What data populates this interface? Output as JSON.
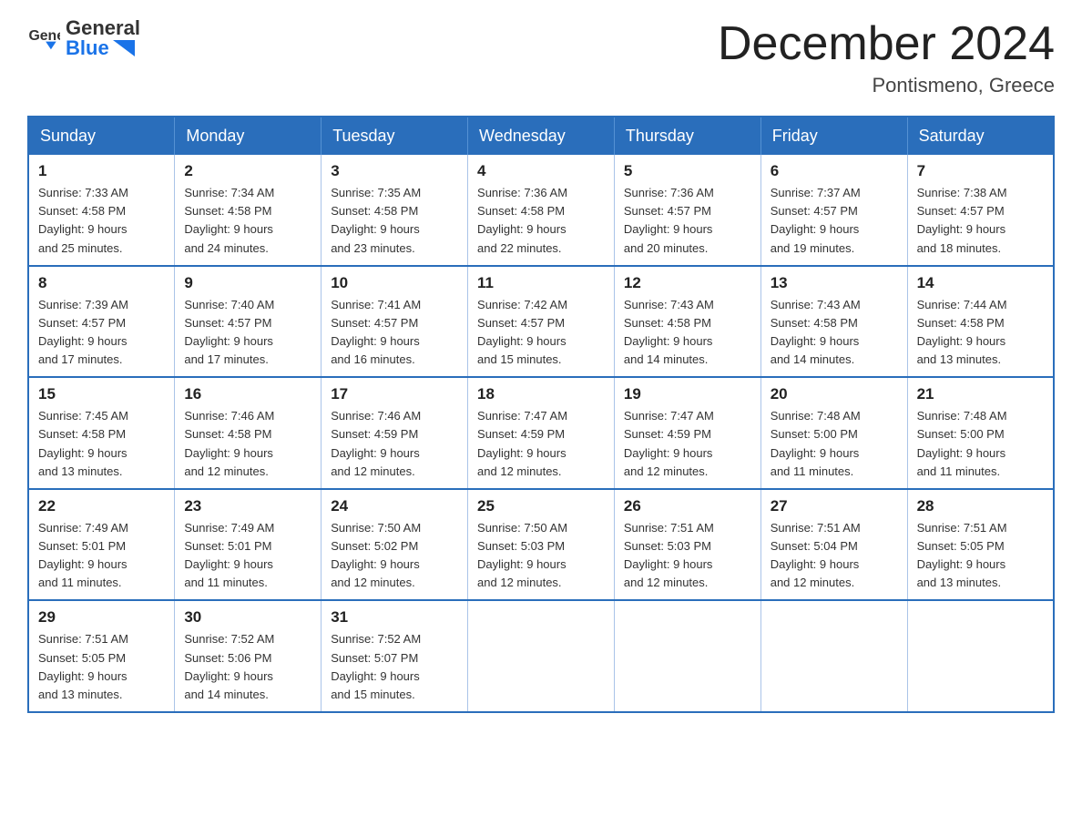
{
  "header": {
    "logo_line1": "General",
    "logo_line2": "Blue",
    "month_title": "December 2024",
    "location": "Pontismeno, Greece"
  },
  "weekdays": [
    "Sunday",
    "Monday",
    "Tuesday",
    "Wednesday",
    "Thursday",
    "Friday",
    "Saturday"
  ],
  "weeks": [
    [
      {
        "day": "1",
        "sunrise": "7:33 AM",
        "sunset": "4:58 PM",
        "daylight": "9 hours and 25 minutes."
      },
      {
        "day": "2",
        "sunrise": "7:34 AM",
        "sunset": "4:58 PM",
        "daylight": "9 hours and 24 minutes."
      },
      {
        "day": "3",
        "sunrise": "7:35 AM",
        "sunset": "4:58 PM",
        "daylight": "9 hours and 23 minutes."
      },
      {
        "day": "4",
        "sunrise": "7:36 AM",
        "sunset": "4:58 PM",
        "daylight": "9 hours and 22 minutes."
      },
      {
        "day": "5",
        "sunrise": "7:36 AM",
        "sunset": "4:57 PM",
        "daylight": "9 hours and 20 minutes."
      },
      {
        "day": "6",
        "sunrise": "7:37 AM",
        "sunset": "4:57 PM",
        "daylight": "9 hours and 19 minutes."
      },
      {
        "day": "7",
        "sunrise": "7:38 AM",
        "sunset": "4:57 PM",
        "daylight": "9 hours and 18 minutes."
      }
    ],
    [
      {
        "day": "8",
        "sunrise": "7:39 AM",
        "sunset": "4:57 PM",
        "daylight": "9 hours and 17 minutes."
      },
      {
        "day": "9",
        "sunrise": "7:40 AM",
        "sunset": "4:57 PM",
        "daylight": "9 hours and 17 minutes."
      },
      {
        "day": "10",
        "sunrise": "7:41 AM",
        "sunset": "4:57 PM",
        "daylight": "9 hours and 16 minutes."
      },
      {
        "day": "11",
        "sunrise": "7:42 AM",
        "sunset": "4:57 PM",
        "daylight": "9 hours and 15 minutes."
      },
      {
        "day": "12",
        "sunrise": "7:43 AM",
        "sunset": "4:58 PM",
        "daylight": "9 hours and 14 minutes."
      },
      {
        "day": "13",
        "sunrise": "7:43 AM",
        "sunset": "4:58 PM",
        "daylight": "9 hours and 14 minutes."
      },
      {
        "day": "14",
        "sunrise": "7:44 AM",
        "sunset": "4:58 PM",
        "daylight": "9 hours and 13 minutes."
      }
    ],
    [
      {
        "day": "15",
        "sunrise": "7:45 AM",
        "sunset": "4:58 PM",
        "daylight": "9 hours and 13 minutes."
      },
      {
        "day": "16",
        "sunrise": "7:46 AM",
        "sunset": "4:58 PM",
        "daylight": "9 hours and 12 minutes."
      },
      {
        "day": "17",
        "sunrise": "7:46 AM",
        "sunset": "4:59 PM",
        "daylight": "9 hours and 12 minutes."
      },
      {
        "day": "18",
        "sunrise": "7:47 AM",
        "sunset": "4:59 PM",
        "daylight": "9 hours and 12 minutes."
      },
      {
        "day": "19",
        "sunrise": "7:47 AM",
        "sunset": "4:59 PM",
        "daylight": "9 hours and 12 minutes."
      },
      {
        "day": "20",
        "sunrise": "7:48 AM",
        "sunset": "5:00 PM",
        "daylight": "9 hours and 11 minutes."
      },
      {
        "day": "21",
        "sunrise": "7:48 AM",
        "sunset": "5:00 PM",
        "daylight": "9 hours and 11 minutes."
      }
    ],
    [
      {
        "day": "22",
        "sunrise": "7:49 AM",
        "sunset": "5:01 PM",
        "daylight": "9 hours and 11 minutes."
      },
      {
        "day": "23",
        "sunrise": "7:49 AM",
        "sunset": "5:01 PM",
        "daylight": "9 hours and 11 minutes."
      },
      {
        "day": "24",
        "sunrise": "7:50 AM",
        "sunset": "5:02 PM",
        "daylight": "9 hours and 12 minutes."
      },
      {
        "day": "25",
        "sunrise": "7:50 AM",
        "sunset": "5:03 PM",
        "daylight": "9 hours and 12 minutes."
      },
      {
        "day": "26",
        "sunrise": "7:51 AM",
        "sunset": "5:03 PM",
        "daylight": "9 hours and 12 minutes."
      },
      {
        "day": "27",
        "sunrise": "7:51 AM",
        "sunset": "5:04 PM",
        "daylight": "9 hours and 12 minutes."
      },
      {
        "day": "28",
        "sunrise": "7:51 AM",
        "sunset": "5:05 PM",
        "daylight": "9 hours and 13 minutes."
      }
    ],
    [
      {
        "day": "29",
        "sunrise": "7:51 AM",
        "sunset": "5:05 PM",
        "daylight": "9 hours and 13 minutes."
      },
      {
        "day": "30",
        "sunrise": "7:52 AM",
        "sunset": "5:06 PM",
        "daylight": "9 hours and 14 minutes."
      },
      {
        "day": "31",
        "sunrise": "7:52 AM",
        "sunset": "5:07 PM",
        "daylight": "9 hours and 15 minutes."
      },
      null,
      null,
      null,
      null
    ]
  ],
  "labels": {
    "sunrise": "Sunrise:",
    "sunset": "Sunset:",
    "daylight": "Daylight:"
  }
}
